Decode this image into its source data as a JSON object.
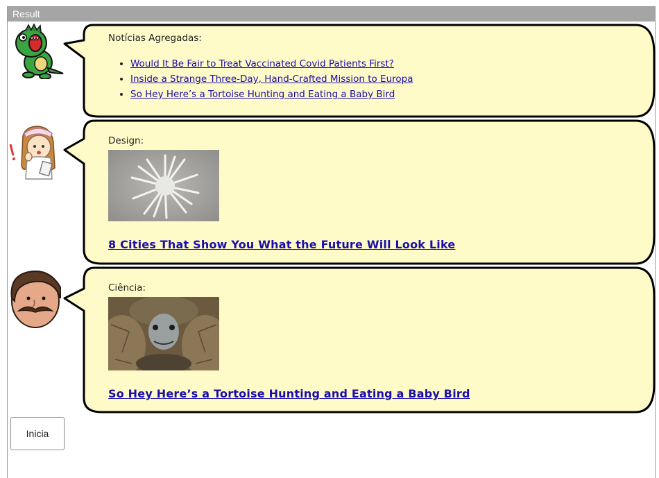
{
  "window": {
    "title": "Result"
  },
  "colors": {
    "bubble_fill": "#fffbc9",
    "bubble_stroke": "#000000",
    "link": "#1a0dab",
    "titlebar": "#a5a5a5"
  },
  "sections": [
    {
      "avatar_icon": "green-dinosaur-avatar",
      "label": "Notícias Agregadas:",
      "items": [
        "Would It Be Fair to Treat Vaccinated Covid Patients First?",
        "Inside a Strange Three-Day, Hand-Crafted Mission to Europa",
        "So Hey Here’s a Tortoise Hunting and Eating a Baby Bird"
      ]
    },
    {
      "avatar_icon": "nurse-avatar",
      "label": "Design:",
      "image_icon": "white-spiky-sculpture-image",
      "link": "8 Cities That Show You What the Future Will Look Like"
    },
    {
      "avatar_icon": "mustache-man-avatar",
      "label": "Ciência:",
      "image_icon": "tortoise-closeup-image",
      "link": "So Hey Here’s a Tortoise Hunting and Eating a Baby Bird"
    }
  ],
  "button": {
    "label": "Inicia"
  }
}
